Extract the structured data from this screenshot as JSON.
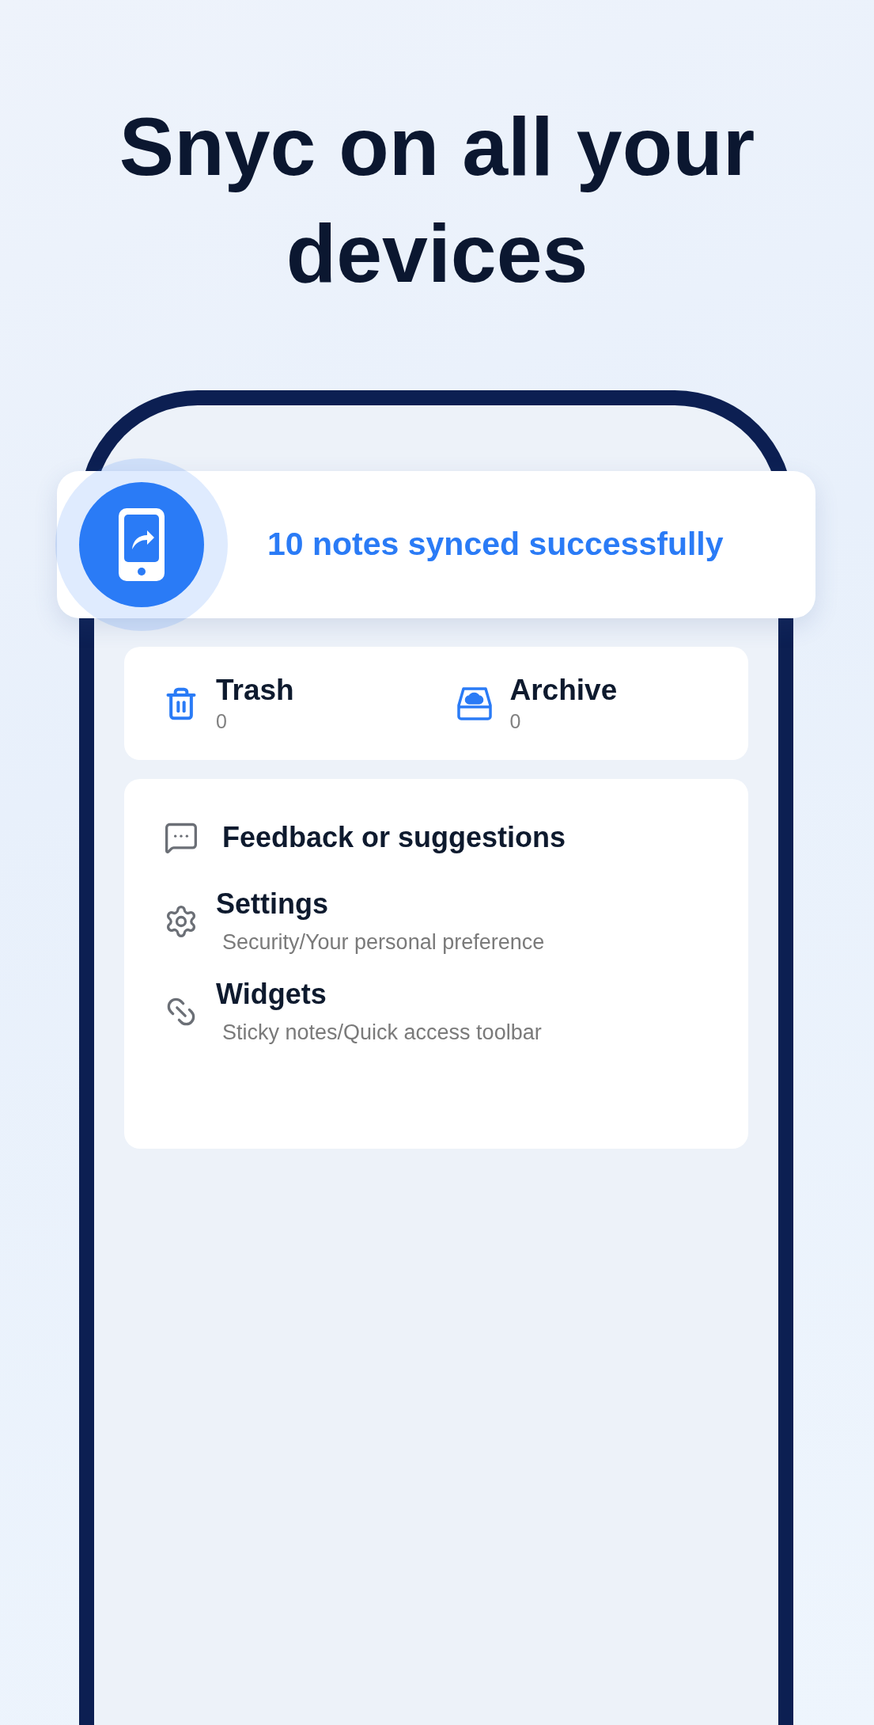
{
  "headline": "Snyc on all your devices",
  "toast": {
    "message": "10 notes synced successfully"
  },
  "shortcuts": [
    {
      "label": "Trash",
      "count": "0",
      "kind": "trash"
    },
    {
      "label": "Archive",
      "count": "0",
      "kind": "archive"
    }
  ],
  "menu": [
    {
      "title": "Feedback or suggestions",
      "kind": "feedback"
    },
    {
      "title": "Settings",
      "subtitle": "Security/Your personal preference",
      "kind": "settings"
    },
    {
      "title": "Widgets",
      "subtitle": "Sticky notes/Quick access toolbar",
      "kind": "widgets"
    }
  ]
}
